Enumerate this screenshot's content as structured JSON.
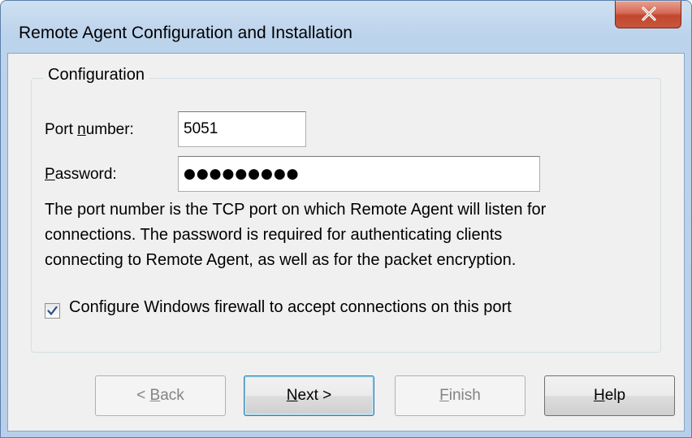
{
  "window": {
    "title": "Remote Agent Configuration and Installation"
  },
  "group": {
    "legend": "Configuration"
  },
  "port": {
    "label_before": "Port ",
    "label_accel": "n",
    "label_after": "umber:",
    "value": "5051"
  },
  "password": {
    "label_accel": "P",
    "label_after": "assword:",
    "masked_value": "●●●●●●●●●"
  },
  "description": {
    "line1": "The port number is the TCP port on which Remote Agent will listen for",
    "line2": "connections. The password is required for authenticating clients",
    "line3": "connecting to Remote Agent, as well as for the packet encryption."
  },
  "firewall": {
    "checked": true,
    "label": "Configure Windows firewall to accept connections on this port"
  },
  "buttons": {
    "back": {
      "prefix": "< ",
      "accel": "B",
      "rest": "ack",
      "enabled": false
    },
    "next": {
      "accel": "N",
      "rest": "ext >",
      "enabled": true
    },
    "finish": {
      "accel": "F",
      "rest": "inish",
      "enabled": false
    },
    "help": {
      "accel": "H",
      "rest": "elp",
      "enabled": true
    }
  },
  "colors": {
    "accent": "#3c7fb1",
    "close_red": "#c8563b",
    "checkmark": "#2d4e8a"
  }
}
